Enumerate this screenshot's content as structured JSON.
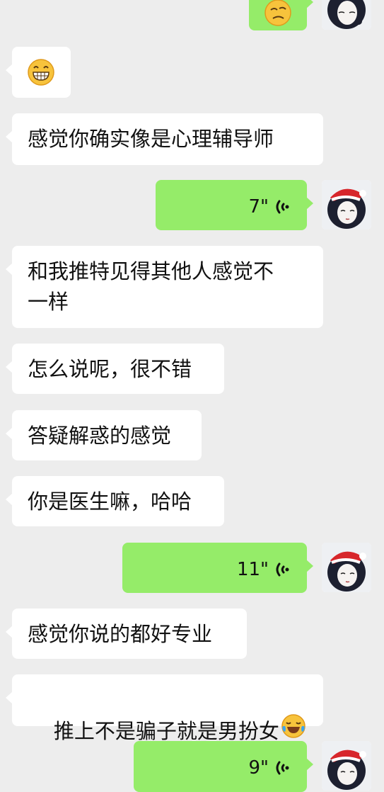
{
  "colors": {
    "background": "#ededed",
    "bubble_received": "#ffffff",
    "bubble_sent": "#95ec69",
    "avatar_hat": "#d7262b"
  },
  "messages": [
    {
      "side": "right",
      "kind": "emoji",
      "emoji": "thinking-face-icon"
    },
    {
      "side": "left",
      "kind": "emoji",
      "emoji": "grinning-face-icon"
    },
    {
      "side": "left",
      "kind": "text",
      "text": "感觉你确实像是心理辅导师"
    },
    {
      "side": "right",
      "kind": "voice",
      "duration": "7\""
    },
    {
      "side": "left",
      "kind": "text",
      "text": "和我推特见得其他人感觉不\n一样"
    },
    {
      "side": "left",
      "kind": "text",
      "text": "怎么说呢，很不错"
    },
    {
      "side": "left",
      "kind": "text",
      "text": "答疑解惑的感觉"
    },
    {
      "side": "left",
      "kind": "text",
      "text": "你是医生嘛，哈哈"
    },
    {
      "side": "right",
      "kind": "voice",
      "duration": "11\""
    },
    {
      "side": "left",
      "kind": "text",
      "text": "感觉你说的都好专业"
    },
    {
      "side": "left",
      "kind": "text",
      "text": "推上不是骗子就是男扮女",
      "emoji": "laughing-tears-face-icon"
    },
    {
      "side": "right",
      "kind": "voice",
      "duration": "9\""
    }
  ]
}
